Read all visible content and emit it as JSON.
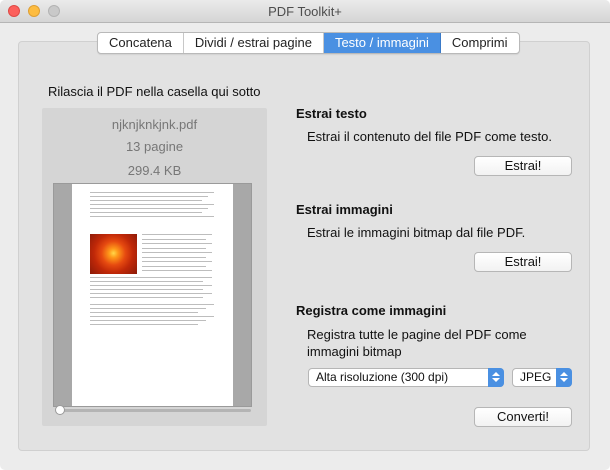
{
  "window": {
    "title": "PDF Toolkit+"
  },
  "tabs": [
    {
      "label": "Concatena",
      "active": false
    },
    {
      "label": "Dividi / estrai pagine",
      "active": false
    },
    {
      "label": "Testo / immagini",
      "active": true
    },
    {
      "label": "Comprimi",
      "active": false
    }
  ],
  "drop": {
    "label": "Rilascia il PDF nella casella qui sotto",
    "file_name": "njknjknkjnk.pdf",
    "pages": "13 pagine",
    "size": "299.4 KB",
    "preview_slider_value": 0
  },
  "extract_text": {
    "title": "Estrai testo",
    "description": "Estrai il contenuto del file PDF come testo.",
    "button": "Estrai!"
  },
  "extract_images": {
    "title": "Estrai immagini",
    "description": "Estrai le immagini bitmap dal file PDF.",
    "button": "Estrai!"
  },
  "save_as_images": {
    "title": "Registra come immagini",
    "description_line1": "Registra tutte le pagine del PDF come",
    "description_line2": "immagini bitmap",
    "resolution": "Alta risoluzione (300 dpi)",
    "format": "JPEG",
    "button": "Converti!"
  },
  "colors": {
    "accent": "#4a90e2",
    "close": "#fc605c",
    "minimize": "#fdbc40",
    "maximize": "#c9c9c9"
  }
}
